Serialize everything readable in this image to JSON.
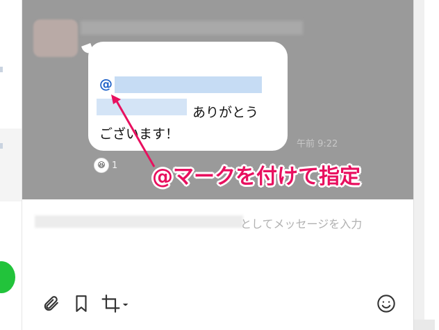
{
  "message": {
    "mention_symbol": "@",
    "line2_text": "ありがとう",
    "line3_text": "ございます！",
    "time": "午前 9:22",
    "reaction": {
      "icon": "laughing-face-icon",
      "count": "1"
    }
  },
  "annotation": {
    "text": "@マークを付けて指定",
    "color": "#e8105f"
  },
  "input": {
    "placeholder_suffix": "としてメッセージを入力"
  },
  "toolbar": {
    "attach_icon": "paperclip-icon",
    "bookmark_icon": "bookmark-icon",
    "crop_icon": "crop-icon",
    "emoji_icon": "smiley-icon"
  },
  "colors": {
    "mention": "#1f62c8",
    "chat_background": "#9a9a9a",
    "accent_green": "#22c33b"
  }
}
